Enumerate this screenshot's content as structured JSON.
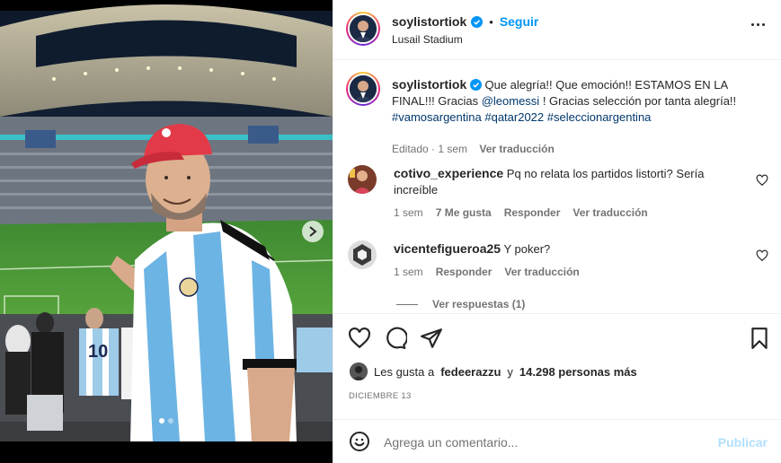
{
  "post": {
    "username": "soylistortiok",
    "follow_label": "Seguir",
    "location": "Lusail Stadium",
    "caption": {
      "text_plain": "Que alegría!! Que emoción!! ESTAMOS EN LA FINAL!!! Gracias ",
      "mention": "@leomessi",
      "text_after": " ! Gracias selección por tanta alegría!! ",
      "hashtags": [
        "#vamosargentina",
        "#qatar2022",
        "#seleccionargentina"
      ],
      "edited": "Editado",
      "time": "1 sem",
      "translate": "Ver traducción"
    },
    "comments": [
      {
        "username": "cotivo_experience",
        "text": "Pq no relata los partidos listorti? Sería increíble",
        "time": "1 sem",
        "likes": "7 Me gusta",
        "reply": "Responder",
        "translate": "Ver traducción"
      },
      {
        "username": "vicentefigueroa25",
        "text": "Y poker?",
        "time": "1 sem",
        "reply": "Responder",
        "translate": "Ver traducción",
        "view_replies": "Ver respuestas (1)"
      }
    ],
    "likes_line": {
      "prefix": "Les gusta a",
      "user": "fedeerazzu",
      "connector": "y",
      "count": "14.298 personas más"
    },
    "date": "DICIEMBRE 13",
    "add_comment": {
      "placeholder": "Agrega un comentario...",
      "publish": "Publicar"
    }
  },
  "icons": {
    "verified": "verified-badge-icon",
    "more": "more-options-icon",
    "like": "heart-icon",
    "comment": "comment-icon",
    "share": "share-icon",
    "save": "bookmark-icon",
    "emoji": "emoji-icon",
    "next": "chevron-right-icon"
  },
  "colors": {
    "accent": "#0095f6",
    "link": "#00376b",
    "muted": "#737373",
    "publish_disabled": "#b2dffc"
  }
}
